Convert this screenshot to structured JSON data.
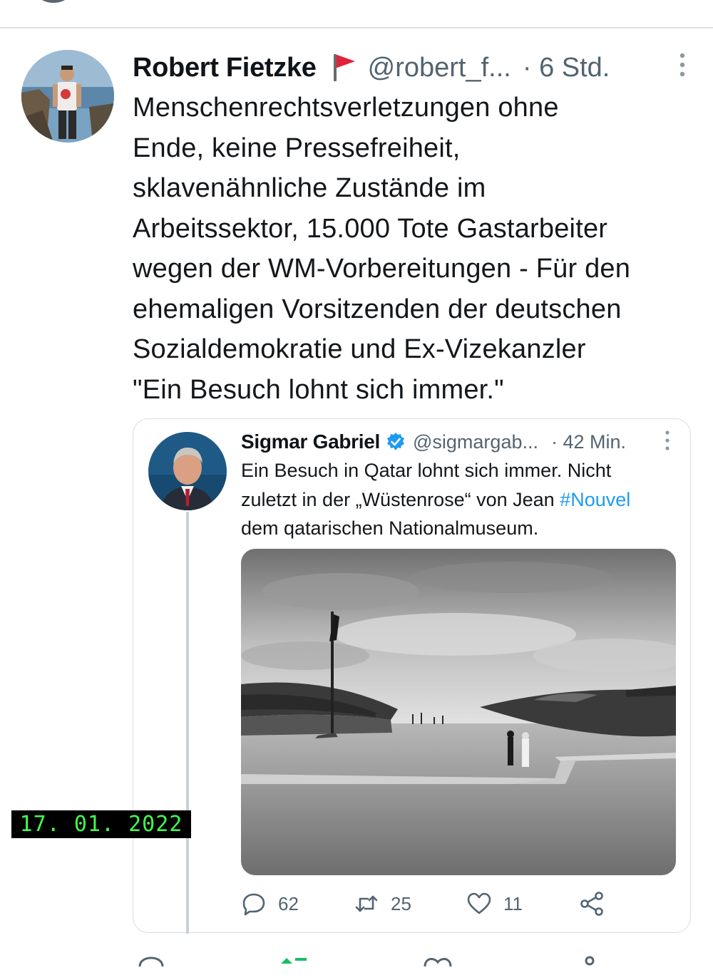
{
  "tweet": {
    "author_name": "Robert Fietzke",
    "handle": "@robert_f...",
    "time": "· 6 Std.",
    "text": "Menschenrechtsverletzungen ohne\nEnde, keine Pressefreiheit,\nsklavenähnliche Zustände im\nArbeitssektor, 15.000 Tote Gastarbeiter\nwegen der WM-Vorbereitungen - Für den\nehemaligen Vorsitzenden der deutschen\nSozialdemokratie und Ex-Vizekanzler\n\"Ein Besuch lohnt sich immer.\""
  },
  "quoted": {
    "author_name": "Sigmar Gabriel",
    "handle": "@sigmargab...",
    "time": "· 42 Min.",
    "text_line1": "Ein Besuch in Qatar lohnt sich immer. Nicht",
    "text_line2_pre": "zuletzt in der „Wüstenrose“ von Jean ",
    "hashtag": "#Nouvel",
    "text_line3": "dem qatarischen  Nationalmuseum.",
    "actions": {
      "replies": "62",
      "retweets": "25",
      "likes": "11"
    }
  },
  "date_stamp": "17. 01. 2022",
  "colors": {
    "link": "#1d9bf0",
    "muted": "#536471",
    "flag": "#e0223a",
    "stamp_text": "#3fff4b"
  },
  "icons": [
    "flag-icon",
    "more-icon",
    "verified-icon",
    "reply-icon",
    "retweet-icon",
    "like-icon",
    "share-icon"
  ]
}
